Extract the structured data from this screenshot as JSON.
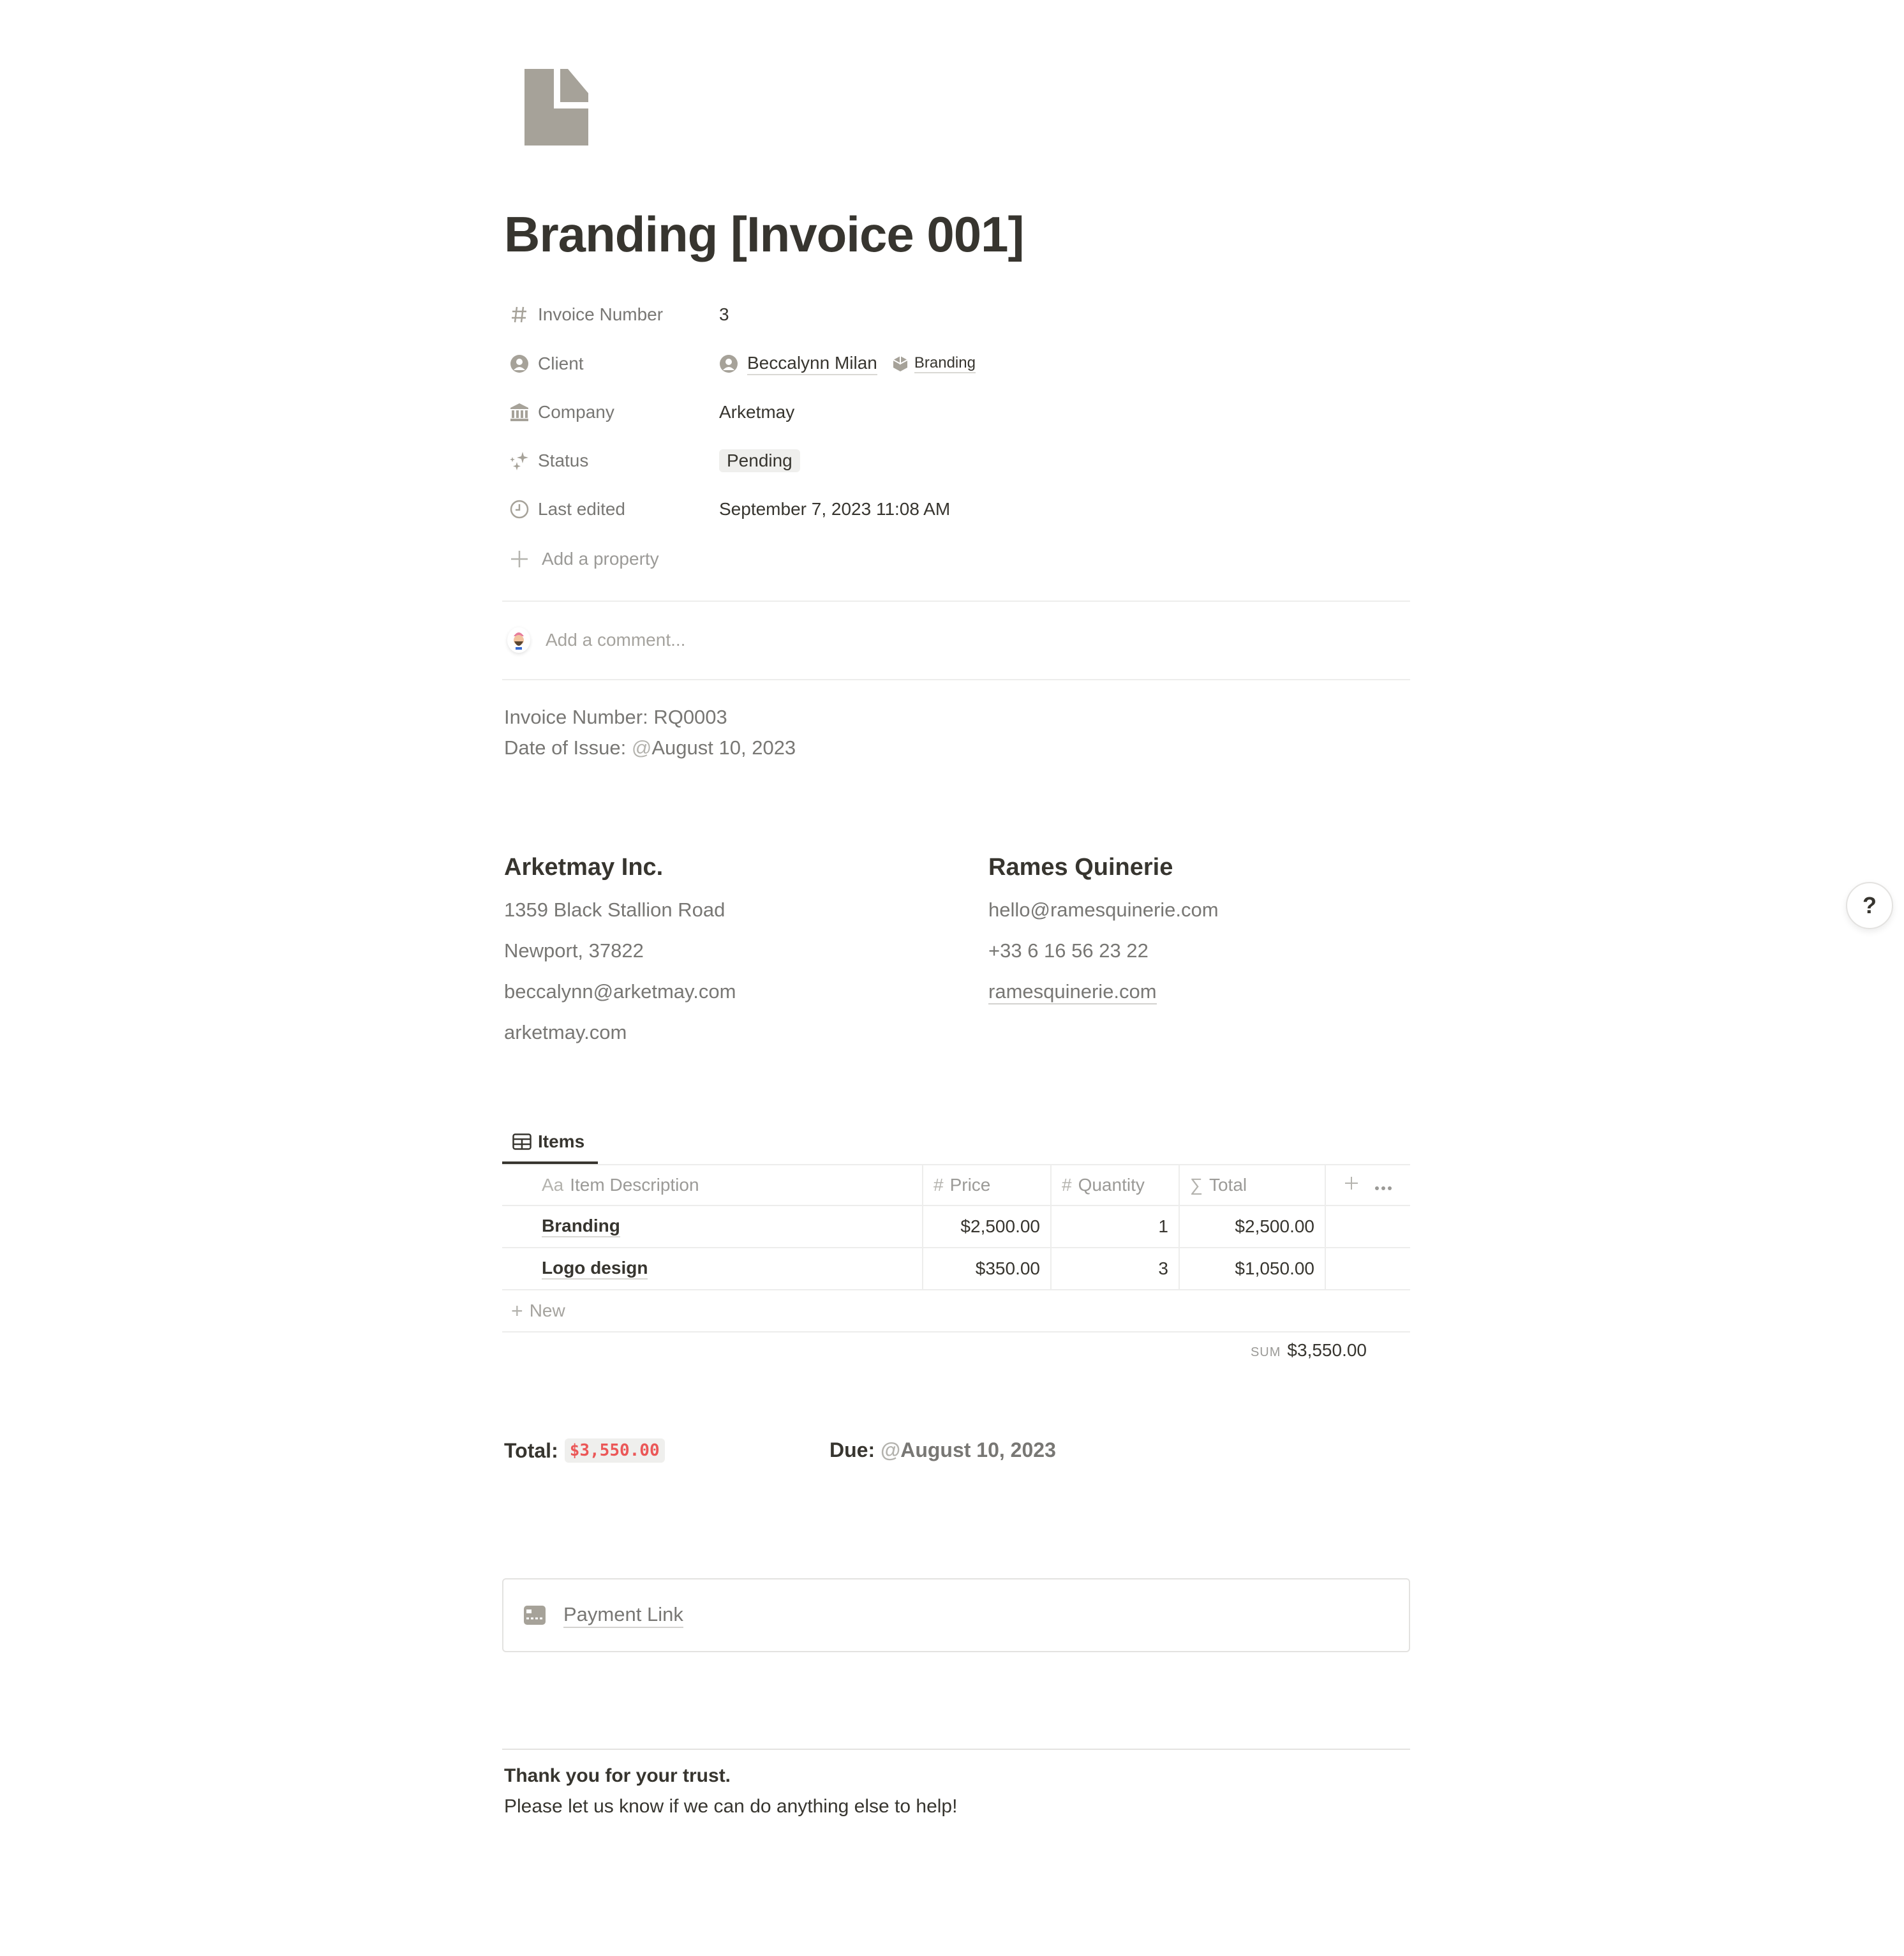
{
  "page": {
    "icon": "document-icon",
    "title": "Branding [Invoice 001]"
  },
  "properties": {
    "invoice_number": {
      "label": "Invoice Number",
      "icon": "hash-icon",
      "value": "3"
    },
    "client": {
      "label": "Client",
      "icon": "person-circle-icon",
      "person": "Beccalynn Milan",
      "project": "Branding"
    },
    "company": {
      "label": "Company",
      "icon": "bank-icon",
      "value": "Arketmay"
    },
    "status": {
      "label": "Status",
      "icon": "sparkle-icon",
      "value": "Pending"
    },
    "last_edited": {
      "label": "Last edited",
      "icon": "clock-icon",
      "value": "September 7, 2023 11:08 AM"
    },
    "add_property": "Add a property"
  },
  "comment": {
    "placeholder": "Add a comment..."
  },
  "invoice_info": {
    "number_line": "Invoice Number: RQ0003",
    "date_label": "Date of Issue: ",
    "date_at": "@",
    "date_value": "August 10, 2023"
  },
  "sender": {
    "name": "Arketmay Inc.",
    "address1": "1359 Black Stallion Road",
    "address2": "Newport, 37822",
    "email": "beccalynn@arketmay.com",
    "website": "arketmay.com"
  },
  "recipient": {
    "name": "Rames Quinerie",
    "email": "hello@ramesquinerie.com",
    "phone": "+33 6 16 56 23 22",
    "website": "ramesquinerie.com"
  },
  "items": {
    "tab_label": "Items",
    "columns": [
      {
        "icon": "Aa",
        "label": "Item Description"
      },
      {
        "icon": "#",
        "label": "Price"
      },
      {
        "icon": "#",
        "label": "Quantity"
      },
      {
        "icon": "∑",
        "label": "Total"
      }
    ],
    "rows": [
      {
        "description": "Branding",
        "price": "$2,500.00",
        "quantity": "1",
        "total": "$2,500.00"
      },
      {
        "description": "Logo design",
        "price": "$350.00",
        "quantity": "3",
        "total": "$1,050.00"
      }
    ],
    "new_label": "New",
    "sum_label": "SUM",
    "sum_value": "$3,550.00"
  },
  "summary": {
    "total_label": "Total:",
    "total_value": "$3,550.00",
    "due_label": "Due:",
    "due_at": "@",
    "due_value": "August 10, 2023"
  },
  "payment": {
    "label": "Payment Link",
    "icon": "credit-card-icon"
  },
  "footer": {
    "thanks": "Thank you for your trust.",
    "message": "Please let us know if we can do anything else to help!"
  },
  "help": {
    "label": "?"
  },
  "colors": {
    "text": "#37352f",
    "muted": "#787774",
    "code_red": "#eb5757",
    "icon_gray": "#a6a299"
  }
}
